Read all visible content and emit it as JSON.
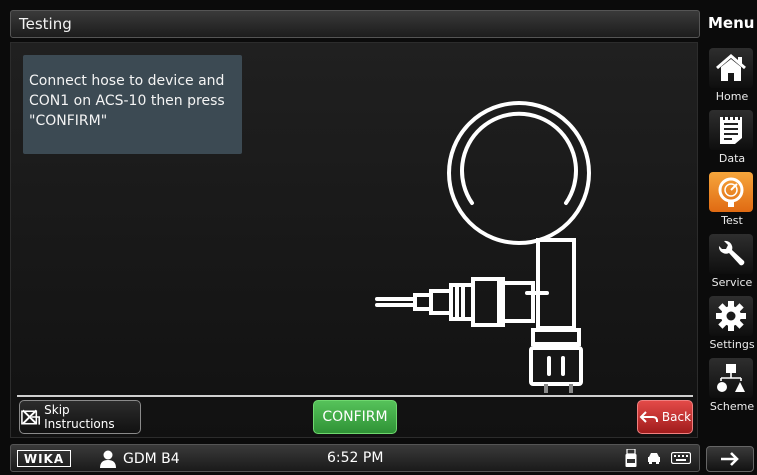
{
  "header": {
    "title": "Testing"
  },
  "instruction": {
    "text": "Connect hose to device and CON1 on ACS-10 then press \"CONFIRM\""
  },
  "actions": {
    "skip_label": "Skip Instructions",
    "confirm_label": "CONFIRM",
    "back_label": "Back"
  },
  "menu": {
    "title": "Menu",
    "items": [
      {
        "label": "Home",
        "icon": "home-icon",
        "active": false
      },
      {
        "label": "Data",
        "icon": "document-icon",
        "active": false
      },
      {
        "label": "Test",
        "icon": "gauge-icon",
        "active": true
      },
      {
        "label": "Service",
        "icon": "wrench-icon",
        "active": false
      },
      {
        "label": "Settings",
        "icon": "gear-icon",
        "active": false
      },
      {
        "label": "Scheme",
        "icon": "scheme-icon",
        "active": false
      }
    ]
  },
  "status": {
    "logo": "WIKA",
    "user": "GDM B4",
    "time": "6:52 PM",
    "icons": [
      "usb-icon",
      "car-icon",
      "keyboard-icon"
    ]
  },
  "colors": {
    "accent_active": "#f08a24",
    "confirm": "#3fae46",
    "back": "#c62828",
    "instruction_bg": "#3c4a53"
  }
}
